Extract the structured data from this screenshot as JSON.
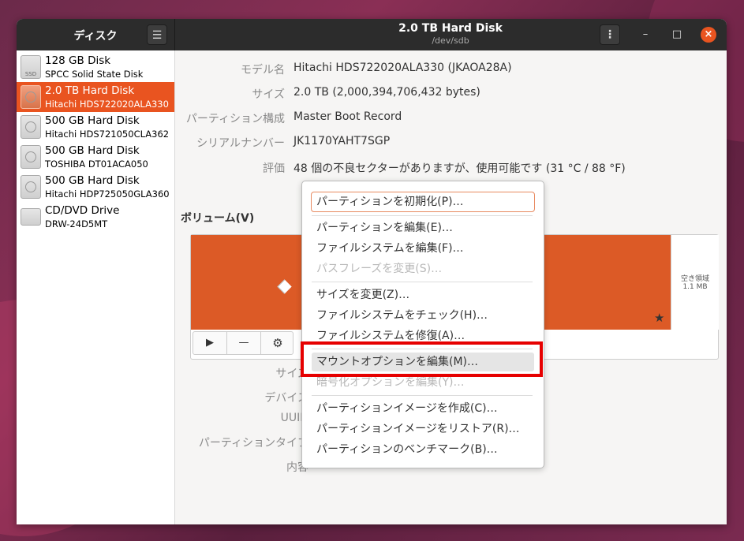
{
  "app": {
    "sidebar_title": "ディスク",
    "menu_glyph": "☰",
    "title": "2.0 TB Hard Disk",
    "subtitle": "/dev/sdb",
    "kebab_glyph": "⋮",
    "minimize_glyph": "–",
    "maximize_glyph": "□",
    "close_glyph": "×",
    "accent_color": "#e95420"
  },
  "disks": [
    {
      "name": "128 GB Disk",
      "model": "SPCC Solid State Disk",
      "icon": "ssd-icon"
    },
    {
      "name": "2.0 TB Hard Disk",
      "model": "Hitachi HDS722020ALA330",
      "icon": "hdd-icon",
      "selected": true
    },
    {
      "name": "500 GB Hard Disk",
      "model": "Hitachi HDS721050CLA362",
      "icon": "hdd-icon"
    },
    {
      "name": "500 GB Hard Disk",
      "model": "TOSHIBA DT01ACA050",
      "icon": "hdd-icon"
    },
    {
      "name": "500 GB Hard Disk",
      "model": "Hitachi HDP725050GLA360",
      "icon": "hdd-icon"
    },
    {
      "name": "CD/DVD Drive",
      "model": "DRW-24D5MT",
      "icon": "optical-drive-icon"
    }
  ],
  "properties": [
    {
      "label": "モデル名",
      "value": "Hitachi HDS722020ALA330 (JKAOA28A)"
    },
    {
      "label": "サイズ",
      "value": "2.0 TB (2,000,394,706,432 bytes)"
    },
    {
      "label": "パーティション構成",
      "value": "Master Boot Record"
    },
    {
      "label": "シリアルナンバー",
      "value": "JK1170YAHT7SGP"
    },
    {
      "label": "評価",
      "value": "48 個の不良セクターがありますが、使用可能です (31 °C / 88 °F)"
    }
  ],
  "volumes": {
    "title": "ボリューム(V)",
    "free_label": "空き領域",
    "free_size": "1.1 MB",
    "star_glyph": "★",
    "play_glyph": "▶",
    "minus_glyph": "—",
    "gear_glyph": "⚙"
  },
  "partition_labels": [
    "サイズ",
    "デバイス",
    "UUID",
    "パーティションタイプ",
    "内容"
  ],
  "menu": {
    "items": [
      {
        "label": "パーティションを初期化(P)…",
        "state": "focused"
      },
      {
        "label": "パーティションを編集(E)…",
        "state": "normal"
      },
      {
        "label": "ファイルシステムを編集(F)…",
        "state": "normal"
      },
      {
        "label": "パスフレーズを変更(S)…",
        "state": "disabled"
      },
      {
        "label": "サイズを変更(Z)…",
        "state": "normal"
      },
      {
        "label": "ファイルシステムをチェック(H)…",
        "state": "normal"
      },
      {
        "label": "ファイルシステムを修復(A)…",
        "state": "normal"
      },
      {
        "label": "マウントオプションを編集(M)…",
        "state": "hovered"
      },
      {
        "label": "暗号化オプションを編集(Y)…",
        "state": "disabled"
      },
      {
        "label": "パーティションイメージを作成(C)…",
        "state": "normal"
      },
      {
        "label": "パーティションイメージをリストア(R)…",
        "state": "normal"
      },
      {
        "label": "パーティションのベンチマーク(B)…",
        "state": "normal"
      }
    ]
  },
  "annotation_color": "#e60000"
}
